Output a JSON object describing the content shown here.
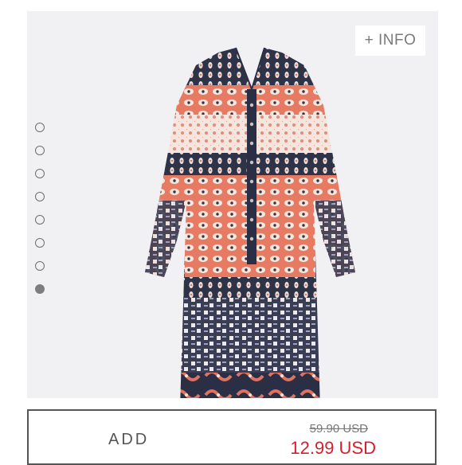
{
  "info_button": {
    "label": "+ INFO"
  },
  "gallery": {
    "image_count": 8,
    "active_index": 7
  },
  "purchase": {
    "add_label": "ADD",
    "original_price": "59.90 USD",
    "sale_price": "12.99 USD"
  },
  "colors": {
    "image_bg": "#f1f1f3",
    "sale_red": "#d81e2a",
    "navy": "#2b2f45",
    "coral": "#e0725f",
    "cream": "#f4e4da"
  }
}
